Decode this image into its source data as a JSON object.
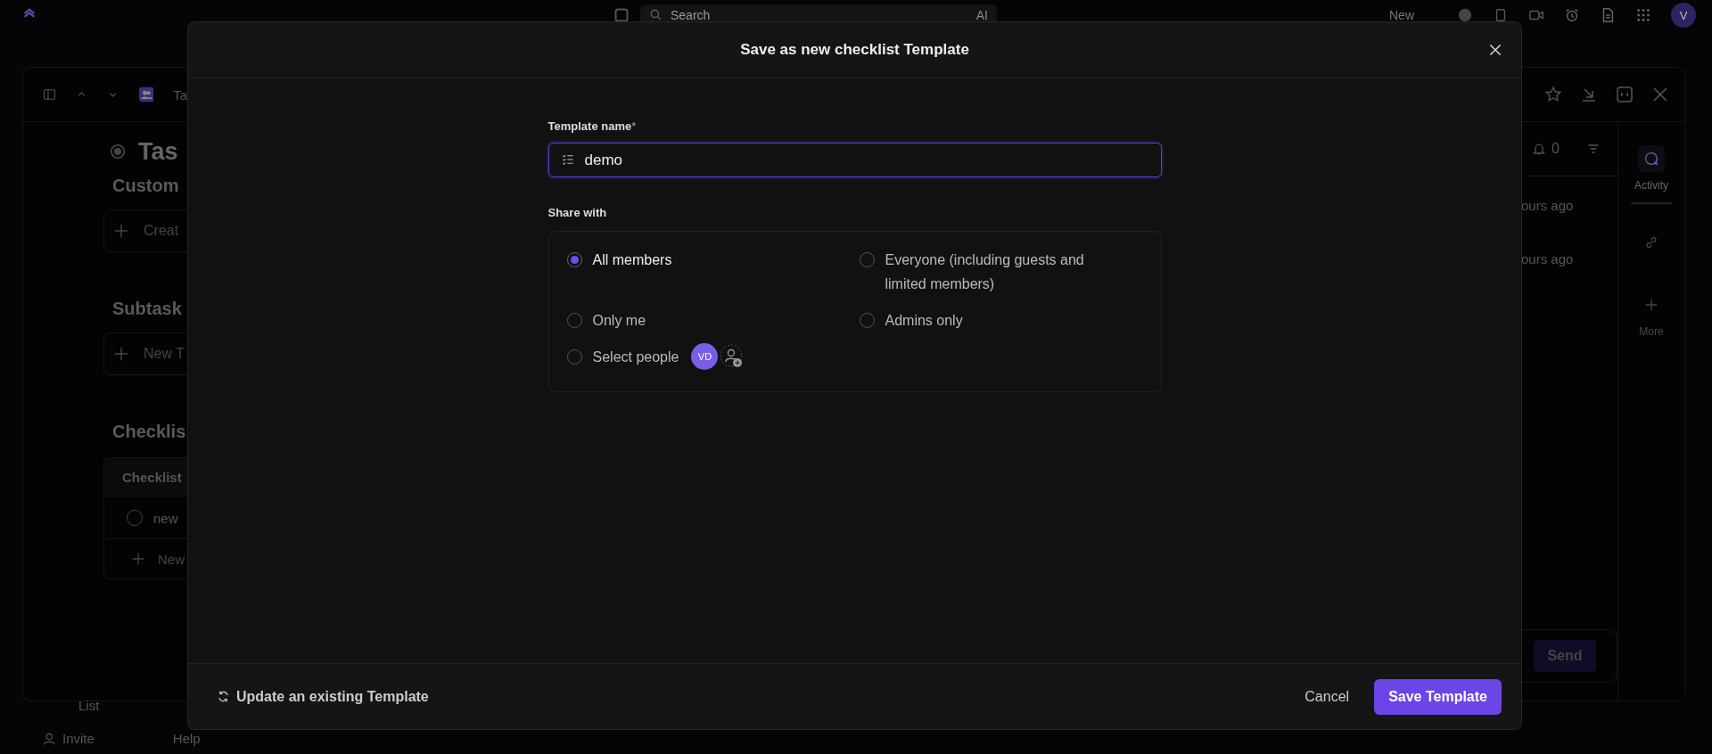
{
  "top_bar": {
    "search": {
      "placeholder": "Search"
    },
    "ai_label": "AI",
    "new_button": "New",
    "avatar": "V"
  },
  "task_panel": {
    "tab_label": "Ta",
    "title": "Tas",
    "sections": [
      {
        "heading": "Custom",
        "add_label": "Creat"
      },
      {
        "heading": "Subtask",
        "add_label": "New T"
      }
    ],
    "checklist": {
      "heading": "Checklis",
      "table_header": "Checklist",
      "items": [
        {
          "label": "new",
          "checked": false
        }
      ],
      "add_label": "New"
    },
    "activity": {
      "notification_count": "0",
      "entries": [
        {
          "time": "ours ago"
        },
        {
          "time": "ours ago"
        }
      ],
      "send_button": "Send"
    },
    "side_tabs": [
      {
        "label": "Activity",
        "selected": true
      },
      {
        "label": "More",
        "selected": false
      }
    ]
  },
  "sidebar_footer": {
    "list_label": "List",
    "invite_label": "Invite",
    "help_label": "Help"
  },
  "modal": {
    "title": "Save as new checklist Template",
    "name_label": "Template name",
    "required_mark": "*",
    "name_value": "demo",
    "share_label": "Share with",
    "share_options": [
      {
        "label": "All members",
        "selected": true
      },
      {
        "label": "Everyone (including guests and limited members)",
        "selected": false
      },
      {
        "label": "Only me",
        "selected": false
      },
      {
        "label": "Admins only",
        "selected": false
      },
      {
        "label": "Select people",
        "selected": false,
        "avatars": [
          "VD"
        ]
      }
    ],
    "update_link": "Update an existing Template",
    "cancel_button": "Cancel",
    "save_button": "Save Template"
  }
}
